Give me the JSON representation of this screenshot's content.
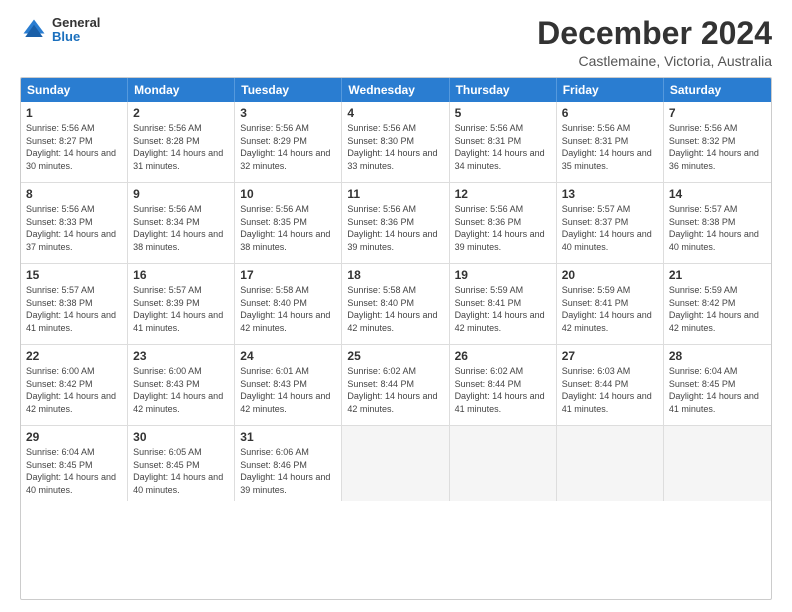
{
  "logo": {
    "general": "General",
    "blue": "Blue"
  },
  "title": "December 2024",
  "location": "Castlemaine, Victoria, Australia",
  "days_of_week": [
    "Sunday",
    "Monday",
    "Tuesday",
    "Wednesday",
    "Thursday",
    "Friday",
    "Saturday"
  ],
  "weeks": [
    [
      {
        "day": "1",
        "sunrise": "5:56 AM",
        "sunset": "8:27 PM",
        "daylight": "14 hours and 30 minutes."
      },
      {
        "day": "2",
        "sunrise": "5:56 AM",
        "sunset": "8:28 PM",
        "daylight": "14 hours and 31 minutes."
      },
      {
        "day": "3",
        "sunrise": "5:56 AM",
        "sunset": "8:29 PM",
        "daylight": "14 hours and 32 minutes."
      },
      {
        "day": "4",
        "sunrise": "5:56 AM",
        "sunset": "8:30 PM",
        "daylight": "14 hours and 33 minutes."
      },
      {
        "day": "5",
        "sunrise": "5:56 AM",
        "sunset": "8:31 PM",
        "daylight": "14 hours and 34 minutes."
      },
      {
        "day": "6",
        "sunrise": "5:56 AM",
        "sunset": "8:31 PM",
        "daylight": "14 hours and 35 minutes."
      },
      {
        "day": "7",
        "sunrise": "5:56 AM",
        "sunset": "8:32 PM",
        "daylight": "14 hours and 36 minutes."
      }
    ],
    [
      {
        "day": "8",
        "sunrise": "5:56 AM",
        "sunset": "8:33 PM",
        "daylight": "14 hours and 37 minutes."
      },
      {
        "day": "9",
        "sunrise": "5:56 AM",
        "sunset": "8:34 PM",
        "daylight": "14 hours and 38 minutes."
      },
      {
        "day": "10",
        "sunrise": "5:56 AM",
        "sunset": "8:35 PM",
        "daylight": "14 hours and 38 minutes."
      },
      {
        "day": "11",
        "sunrise": "5:56 AM",
        "sunset": "8:36 PM",
        "daylight": "14 hours and 39 minutes."
      },
      {
        "day": "12",
        "sunrise": "5:56 AM",
        "sunset": "8:36 PM",
        "daylight": "14 hours and 39 minutes."
      },
      {
        "day": "13",
        "sunrise": "5:57 AM",
        "sunset": "8:37 PM",
        "daylight": "14 hours and 40 minutes."
      },
      {
        "day": "14",
        "sunrise": "5:57 AM",
        "sunset": "8:38 PM",
        "daylight": "14 hours and 40 minutes."
      }
    ],
    [
      {
        "day": "15",
        "sunrise": "5:57 AM",
        "sunset": "8:38 PM",
        "daylight": "14 hours and 41 minutes."
      },
      {
        "day": "16",
        "sunrise": "5:57 AM",
        "sunset": "8:39 PM",
        "daylight": "14 hours and 41 minutes."
      },
      {
        "day": "17",
        "sunrise": "5:58 AM",
        "sunset": "8:40 PM",
        "daylight": "14 hours and 42 minutes."
      },
      {
        "day": "18",
        "sunrise": "5:58 AM",
        "sunset": "8:40 PM",
        "daylight": "14 hours and 42 minutes."
      },
      {
        "day": "19",
        "sunrise": "5:59 AM",
        "sunset": "8:41 PM",
        "daylight": "14 hours and 42 minutes."
      },
      {
        "day": "20",
        "sunrise": "5:59 AM",
        "sunset": "8:41 PM",
        "daylight": "14 hours and 42 minutes."
      },
      {
        "day": "21",
        "sunrise": "5:59 AM",
        "sunset": "8:42 PM",
        "daylight": "14 hours and 42 minutes."
      }
    ],
    [
      {
        "day": "22",
        "sunrise": "6:00 AM",
        "sunset": "8:42 PM",
        "daylight": "14 hours and 42 minutes."
      },
      {
        "day": "23",
        "sunrise": "6:00 AM",
        "sunset": "8:43 PM",
        "daylight": "14 hours and 42 minutes."
      },
      {
        "day": "24",
        "sunrise": "6:01 AM",
        "sunset": "8:43 PM",
        "daylight": "14 hours and 42 minutes."
      },
      {
        "day": "25",
        "sunrise": "6:02 AM",
        "sunset": "8:44 PM",
        "daylight": "14 hours and 42 minutes."
      },
      {
        "day": "26",
        "sunrise": "6:02 AM",
        "sunset": "8:44 PM",
        "daylight": "14 hours and 41 minutes."
      },
      {
        "day": "27",
        "sunrise": "6:03 AM",
        "sunset": "8:44 PM",
        "daylight": "14 hours and 41 minutes."
      },
      {
        "day": "28",
        "sunrise": "6:04 AM",
        "sunset": "8:45 PM",
        "daylight": "14 hours and 41 minutes."
      }
    ],
    [
      {
        "day": "29",
        "sunrise": "6:04 AM",
        "sunset": "8:45 PM",
        "daylight": "14 hours and 40 minutes."
      },
      {
        "day": "30",
        "sunrise": "6:05 AM",
        "sunset": "8:45 PM",
        "daylight": "14 hours and 40 minutes."
      },
      {
        "day": "31",
        "sunrise": "6:06 AM",
        "sunset": "8:46 PM",
        "daylight": "14 hours and 39 minutes."
      },
      {
        "day": "",
        "sunrise": "",
        "sunset": "",
        "daylight": ""
      },
      {
        "day": "",
        "sunrise": "",
        "sunset": "",
        "daylight": ""
      },
      {
        "day": "",
        "sunrise": "",
        "sunset": "",
        "daylight": ""
      },
      {
        "day": "",
        "sunrise": "",
        "sunset": "",
        "daylight": ""
      }
    ]
  ]
}
